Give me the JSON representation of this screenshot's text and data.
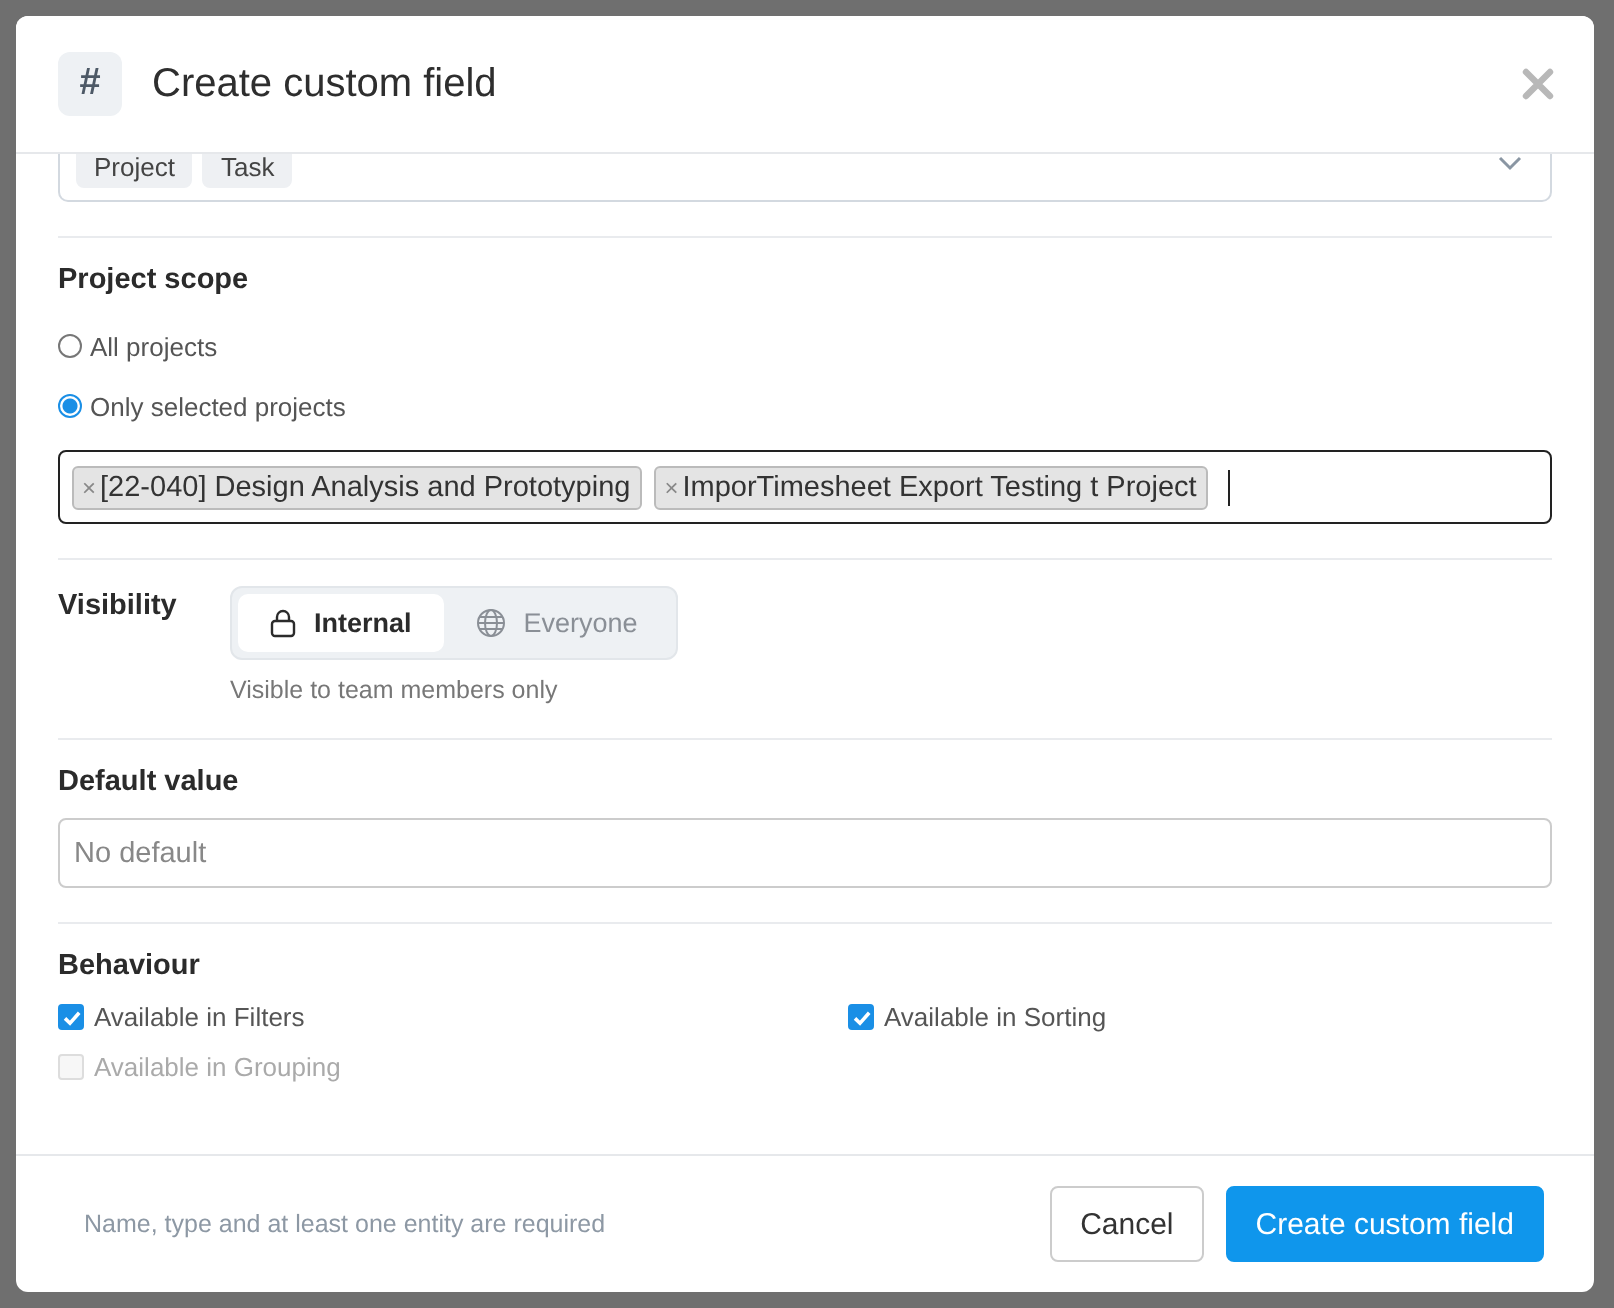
{
  "modal": {
    "title": "Create custom field",
    "icon_glyph": "#"
  },
  "entities": {
    "tags": [
      "Project",
      "Task"
    ]
  },
  "project_scope": {
    "label": "Project scope",
    "remove_glyph": "×",
    "options": [
      {
        "label": "All projects",
        "selected": false
      },
      {
        "label": "Only selected projects",
        "selected": true
      }
    ],
    "projects": [
      "[22-040] Design Analysis and Prototyping",
      "ImporTimesheet Export Testing t Project"
    ]
  },
  "visibility": {
    "label": "Visibility",
    "hint": "Visible to team members only",
    "options": [
      {
        "label": "Internal",
        "kind": "lock",
        "selected": true
      },
      {
        "label": "Everyone",
        "kind": "globe",
        "selected": false
      }
    ]
  },
  "default_value": {
    "label": "Default value",
    "placeholder": "No default"
  },
  "behaviour": {
    "label": "Behaviour",
    "options": [
      {
        "label": "Available in Filters",
        "checked": true,
        "disabled": false
      },
      {
        "label": "Available in Sorting",
        "checked": true,
        "disabled": false
      },
      {
        "label": "Available in Grouping",
        "checked": false,
        "disabled": true
      }
    ]
  },
  "footer": {
    "note": "Name, type and at least one entity are required",
    "buttons": [
      {
        "label": "Cancel",
        "kind": "secondary"
      },
      {
        "label": "Create custom field",
        "kind": "primary"
      }
    ]
  }
}
